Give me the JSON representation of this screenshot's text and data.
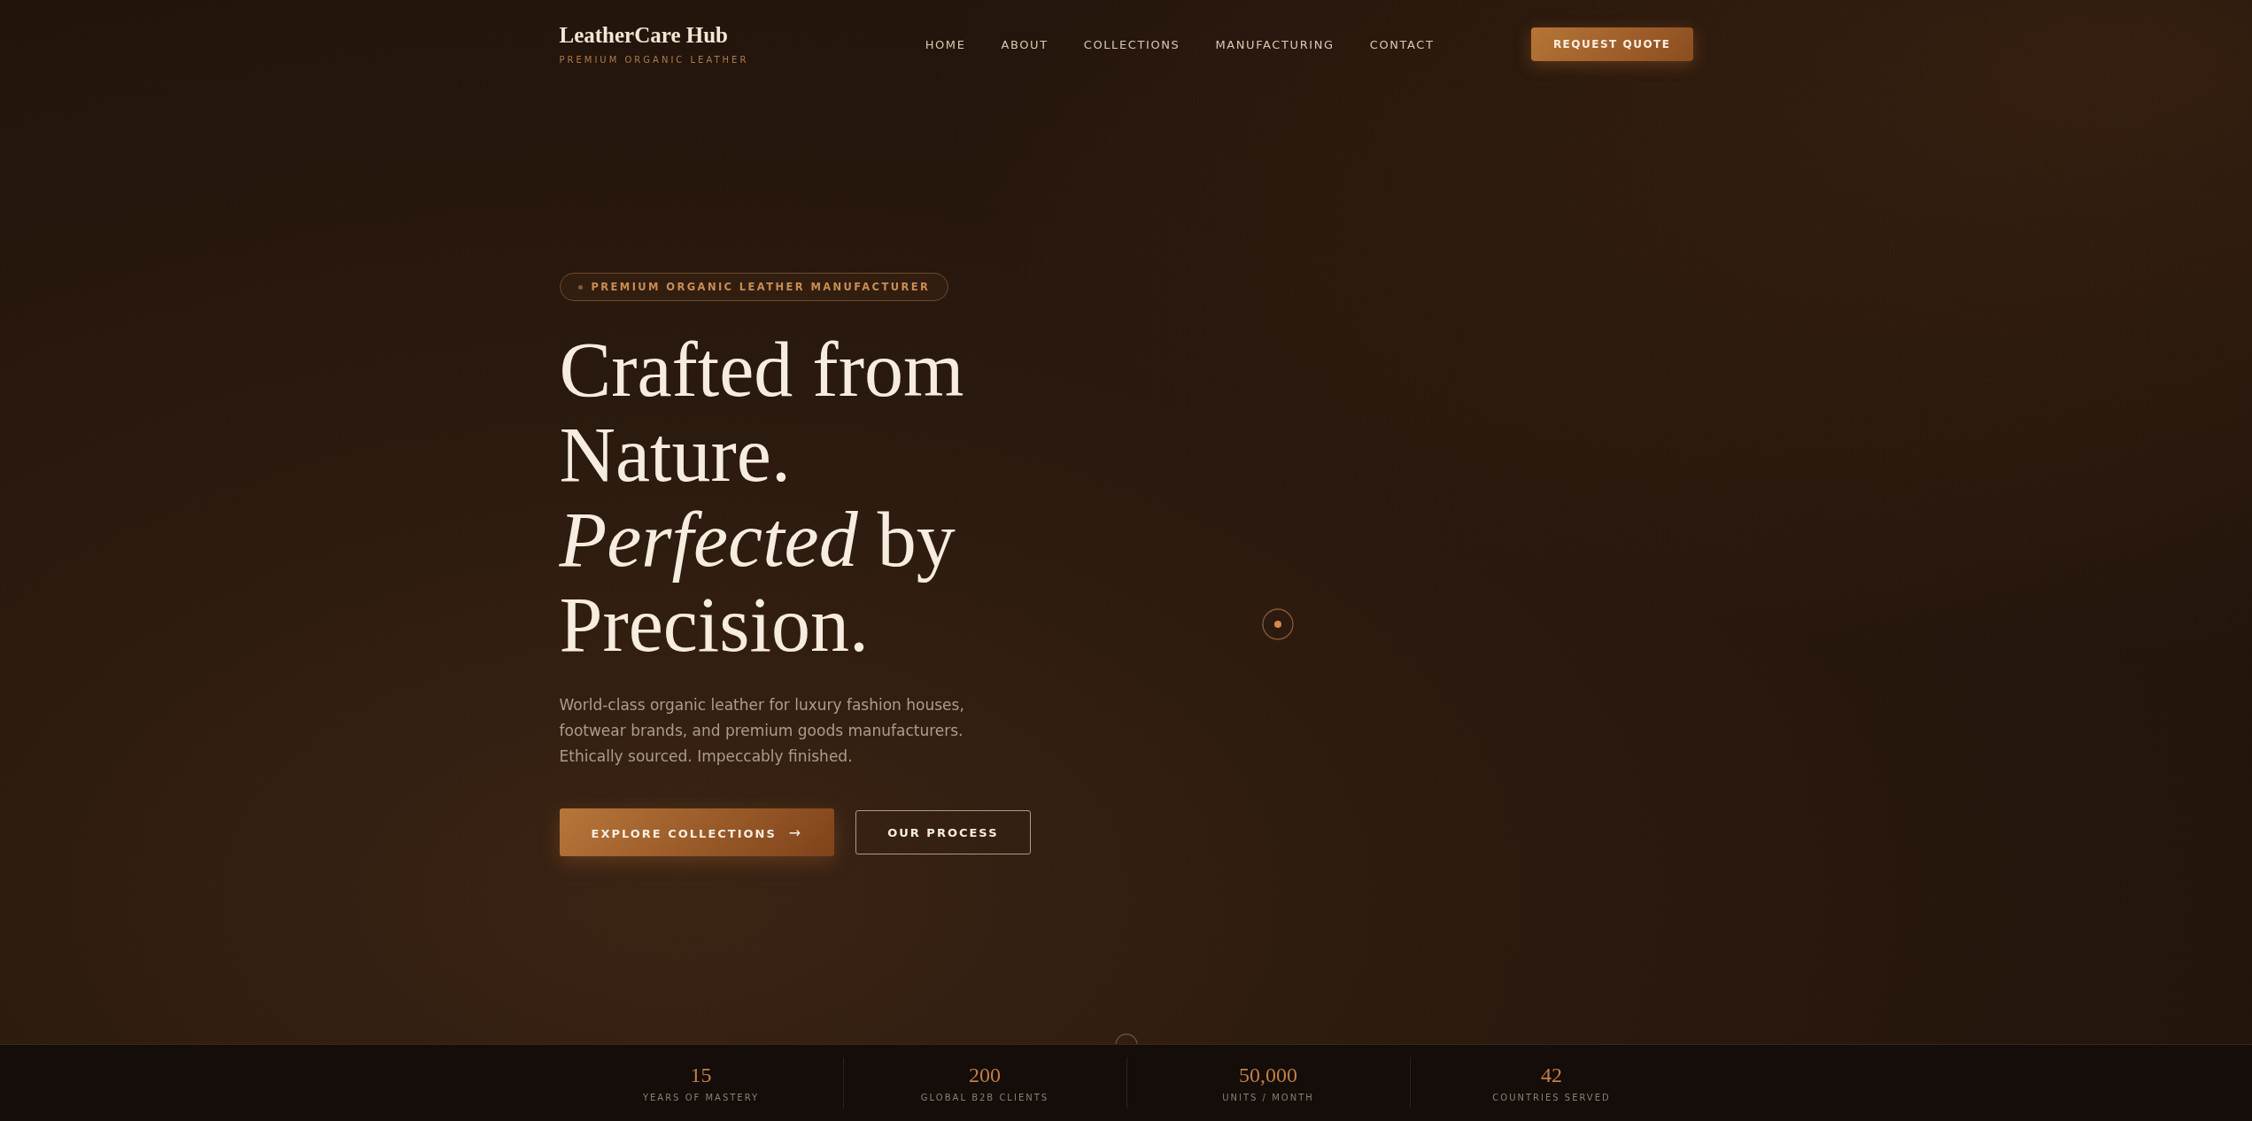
{
  "header": {
    "logo": "LeatherCare Hub",
    "tagline": "PREMIUM ORGANIC LEATHER",
    "nav": [
      {
        "label": "HOME"
      },
      {
        "label": "ABOUT"
      },
      {
        "label": "COLLECTIONS"
      },
      {
        "label": "MANUFACTURING"
      },
      {
        "label": "CONTACT"
      }
    ],
    "cta": "REQUEST QUOTE"
  },
  "hero": {
    "badge": "PREMIUM ORGANIC LEATHER MANUFACTURER",
    "heading": "Crafted from Nature. *Perfected* by Precision.",
    "description": "World-class organic leather for luxury fashion houses, footwear brands, and premium goods manufacturers. Ethically sourced. Impeccably finished.",
    "buttons": [
      {
        "label": "EXPLORE COLLECTIONS",
        "kind": "primary",
        "arrow": "→"
      },
      {
        "label": "OUR PROCESS",
        "kind": "outline"
      }
    ]
  },
  "stats": [
    {
      "value": "15",
      "label": "YEARS OF MASTERY"
    },
    {
      "value": "200",
      "label": "GLOBAL B2B CLIENTS"
    },
    {
      "value": "50,000",
      "label": "UNITS / MONTH"
    },
    {
      "value": "42",
      "label": "COUNTRIES SERVED"
    }
  ]
}
